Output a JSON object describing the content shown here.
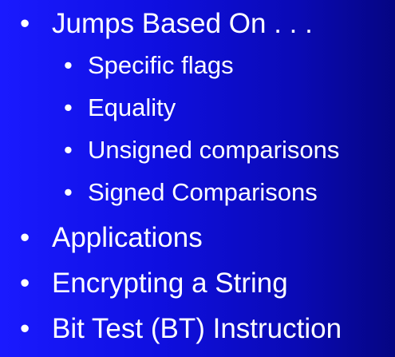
{
  "slide": {
    "bullet_glyph": "•",
    "items": [
      {
        "label": "Jumps Based On . . ."
      },
      {
        "label": "Specific flags"
      },
      {
        "label": "Equality"
      },
      {
        "label": "Unsigned comparisons"
      },
      {
        "label": "Signed Comparisons"
      },
      {
        "label": "Applications"
      },
      {
        "label": "Encrypting a String"
      },
      {
        "label": "Bit Test (BT) Instruction"
      }
    ]
  }
}
